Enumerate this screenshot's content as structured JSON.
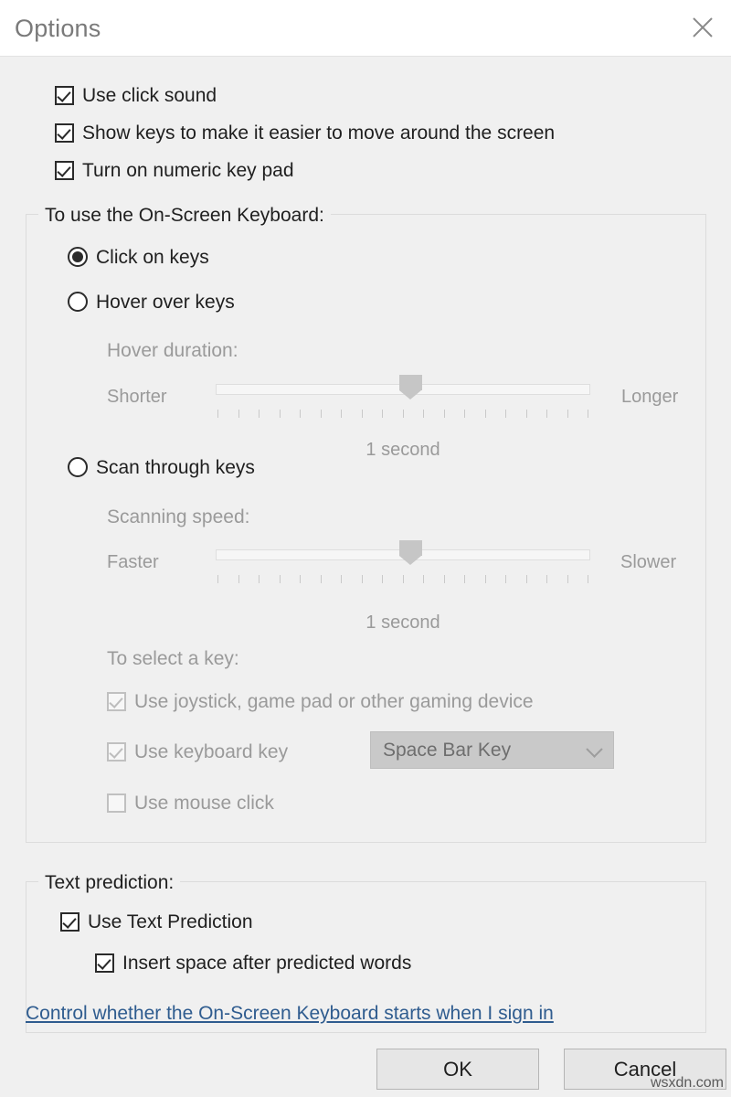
{
  "window": {
    "title": "Options",
    "close_icon": "close-icon"
  },
  "top_checkboxes": [
    {
      "label": "Use click sound",
      "checked": true,
      "enabled": true
    },
    {
      "label": "Show keys to make it easier to move around the screen",
      "checked": true,
      "enabled": true
    },
    {
      "label": "Turn on numeric key pad",
      "checked": true,
      "enabled": true
    }
  ],
  "keyboard_group": {
    "legend": "To use the On-Screen Keyboard:",
    "radios": [
      {
        "label": "Click on keys",
        "selected": true
      },
      {
        "label": "Hover over keys",
        "selected": false
      },
      {
        "label": "Scan through keys",
        "selected": false
      }
    ],
    "hover": {
      "label": "Hover duration:",
      "min_label": "Shorter",
      "max_label": "Longer",
      "value_label": "1 second",
      "tick_count": 19,
      "thumb_percent": 52
    },
    "scan": {
      "label": "Scanning speed:",
      "min_label": "Faster",
      "max_label": "Slower",
      "value_label": "1 second",
      "tick_count": 19,
      "thumb_percent": 52
    },
    "select_key": {
      "label": "To select a key:",
      "options": [
        {
          "label": "Use joystick, game pad or other gaming device",
          "checked": true,
          "enabled": false
        },
        {
          "label": "Use keyboard key",
          "checked": true,
          "enabled": false
        },
        {
          "label": "Use mouse click",
          "checked": false,
          "enabled": false
        }
      ],
      "dropdown": {
        "value": "Space Bar Key",
        "enabled": false,
        "arrow_icon": "chevron-down-icon"
      }
    }
  },
  "text_prediction_group": {
    "legend": "Text prediction:",
    "options": [
      {
        "label": "Use Text Prediction",
        "checked": true,
        "enabled": true
      },
      {
        "label": "Insert space after predicted words",
        "checked": true,
        "enabled": true
      }
    ]
  },
  "link": {
    "label": "Control whether the On-Screen Keyboard starts when I sign in",
    "color": "#2f5c8f"
  },
  "buttons": {
    "ok": "OK",
    "cancel": "Cancel"
  },
  "watermark": "wsxdn.com"
}
